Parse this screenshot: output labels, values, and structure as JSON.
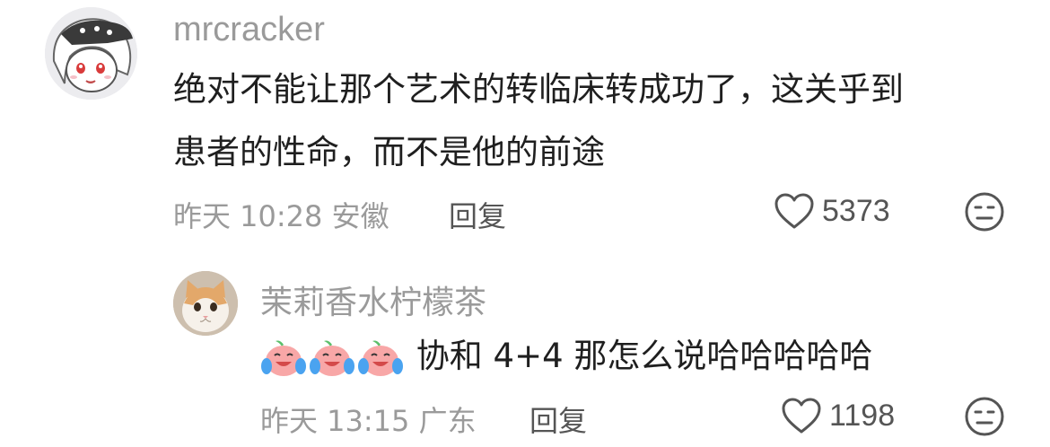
{
  "comments": [
    {
      "username": "mrcracker",
      "text_line1": "绝对不能让那个艺术的转临床转成功了，这关乎到",
      "text_line2": "患者的性命，而不是他的前途",
      "meta": "昨天 10:28 安徽",
      "reply_label": "回复",
      "likes": "5373",
      "avatar": "anime-girl-avatar"
    },
    {
      "username": "茉莉香水柠檬茶",
      "text": "协和 4+4 那怎么说哈哈哈哈哈",
      "emoji_count": 3,
      "emoji": "crying-laughing-peach-emoji",
      "meta": "昨天 13:15 广东",
      "reply_label": "回复",
      "likes": "1198",
      "avatar": "cat-avatar"
    }
  ],
  "icons": {
    "like": "heart-outline-icon",
    "dislike": "unamused-face-icon"
  },
  "colors": {
    "username": "#9a9a9a",
    "text": "#1f1f1f",
    "meta": "#9a9a9a",
    "action": "#555555"
  }
}
